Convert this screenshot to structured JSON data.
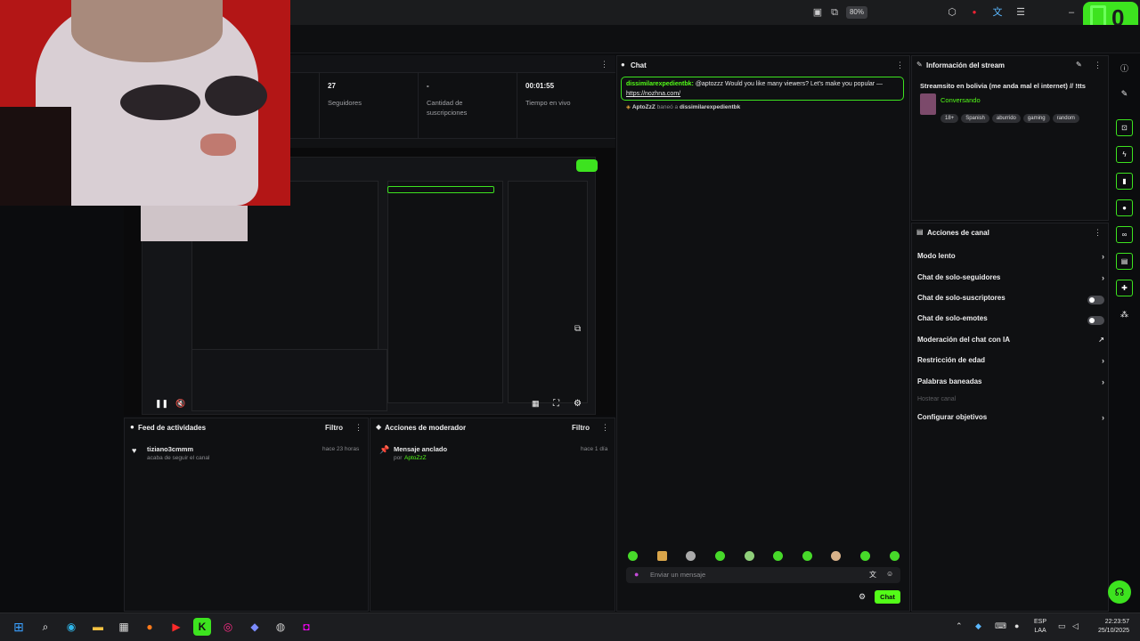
{
  "browser": {
    "zoom": "80%"
  },
  "kick": {
    "badge": "0"
  },
  "stats": [
    {
      "value": "27",
      "label": "Seguidores"
    },
    {
      "value": "-",
      "label": "Cantidad de suscripciones"
    },
    {
      "value": "00:01:55",
      "label": "Tiempo en vivo"
    }
  ],
  "chat": {
    "title": "Chat",
    "message_user": "dissimilarexpedientbk:",
    "message_text": "@aptozzz Would you like many viewers? Let's make you popular —",
    "message_link": "https://nozhna.com/",
    "ban_user": "AptoZzZ",
    "ban_text": "baneó a",
    "ban_target": "dissimilarexpedientbk",
    "input_placeholder": "Enviar un mensaje",
    "send_label": "Chat"
  },
  "stream_info": {
    "title": "Información del stream",
    "stream_title": "Streamsito en bolivia (me anda mal el internet) // !tts",
    "category": "Conversando",
    "tags": [
      "18+",
      "Spanish",
      "aburrido",
      "gaming",
      "random"
    ]
  },
  "channel_actions": {
    "title": "Acciones de canal",
    "items": [
      {
        "label": "Modo lento",
        "type": "chevron"
      },
      {
        "label": "Chat de solo-seguidores",
        "type": "chevron"
      },
      {
        "label": "Chat de solo-suscriptores",
        "type": "toggle"
      },
      {
        "label": "Chat de solo-emotes",
        "type": "toggle"
      },
      {
        "label": "Moderación del chat con IA",
        "type": "external"
      },
      {
        "label": "Restricción de edad",
        "type": "chevron"
      },
      {
        "label": "Palabras baneadas",
        "type": "chevron"
      },
      {
        "label": "Hostear canal",
        "type": "disabled"
      },
      {
        "label": "Configurar objetivos",
        "type": "chevron"
      }
    ]
  },
  "activity_feed": {
    "title": "Feed de actividades",
    "filter": "Filtro",
    "item_user": "tiziano3cmmm",
    "item_text": "acaba de seguir el canal",
    "item_time": "hace 23 horas"
  },
  "mod_actions": {
    "title": "Acciones de moderador",
    "filter": "Filtro",
    "item_title": "Mensaje anclado",
    "item_by": "por",
    "item_user": "AptoZzZ",
    "item_time": "hace 1 día"
  },
  "taskbar": {
    "lang": "ESP",
    "lang2": "LAA",
    "time": "22:23:57",
    "date": "25/10/2025"
  }
}
